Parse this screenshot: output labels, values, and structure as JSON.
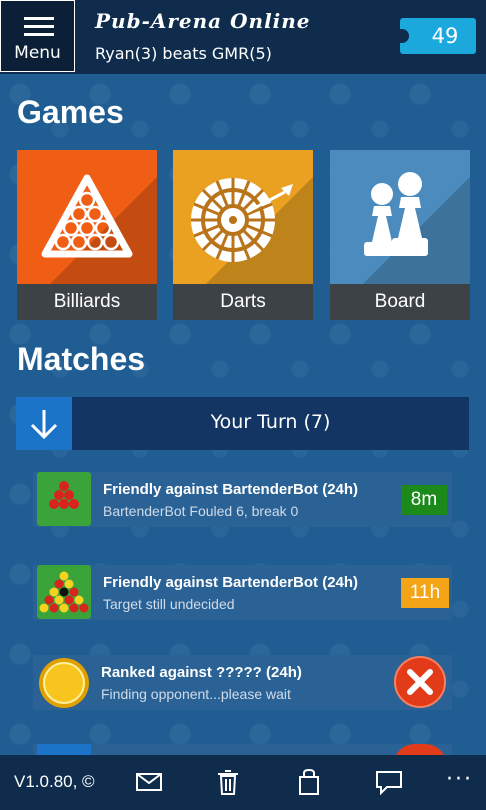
{
  "header": {
    "menu_label": "Menu",
    "app_title": "Pub-Arena Online",
    "subtitle": "Ryan(3) beats GMR(5)",
    "coins": "49"
  },
  "games": {
    "title": "Games",
    "tiles": [
      {
        "label": "Billiards",
        "color": "#f05d14",
        "icon": "billiard-rack-icon"
      },
      {
        "label": "Darts",
        "color": "#eaa021",
        "icon": "dartboard-icon"
      },
      {
        "label": "Board",
        "color": "#4b8bbd",
        "icon": "chess-pawns-icon"
      }
    ]
  },
  "matches": {
    "title": "Matches",
    "filter_label": "Your Turn (7)",
    "items": [
      {
        "title": "Friendly against BartenderBot (24h)",
        "subtitle": "BartenderBot Fouled 6, break 0",
        "badge": "8m",
        "badge_color": "#1b8a1b",
        "icon": "snooker-triangle-icon"
      },
      {
        "title": "Friendly against BartenderBot (24h)",
        "subtitle": "Target still undecided",
        "badge": "11h",
        "badge_color": "#f4a417",
        "icon": "pool-rack-icon"
      },
      {
        "title": "Ranked against ????? (24h)",
        "subtitle": "Finding opponent...please wait",
        "badge": "",
        "badge_color": "#e23b1a",
        "icon": "gold-coin-icon"
      }
    ]
  },
  "appbar": {
    "version": "V1.0.80, ©",
    "icons": [
      "mail-icon",
      "trash-icon",
      "shopping-bag-icon",
      "chat-icon",
      "more-icon"
    ],
    "more": "···"
  }
}
